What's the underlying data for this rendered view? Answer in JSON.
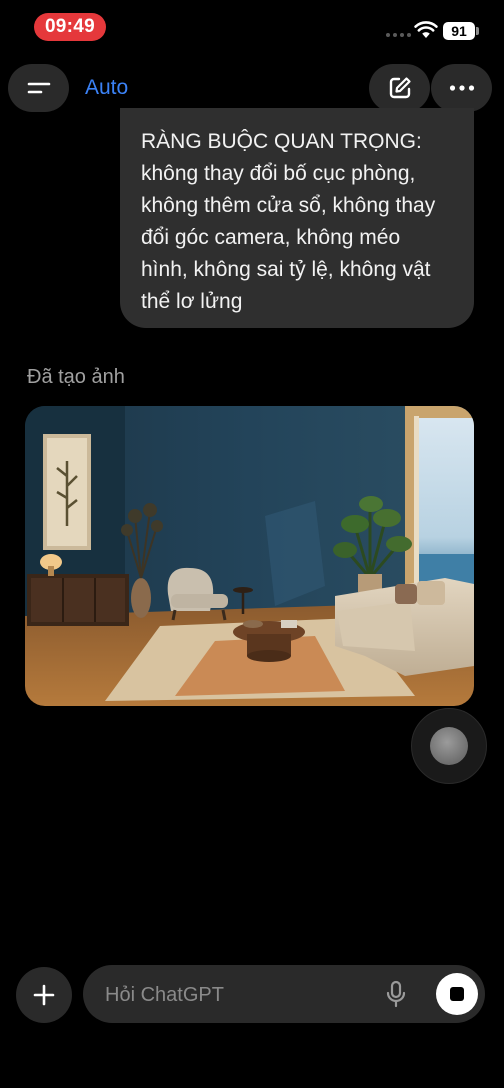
{
  "status_bar": {
    "time": "09:49",
    "battery": "91",
    "time_pill_color": "#e5383b"
  },
  "header": {
    "menu_icon": "menu-lines-icon",
    "model_label": "Auto",
    "new_chat_icon": "edit-icon",
    "more_icon": "more-horizontal-icon",
    "accent_color": "#3b82f6"
  },
  "conversation": {
    "user_message_lines": [
      "RÀNG BUỘC QUAN TRỌNG:",
      "không thay đổi bố cục phòng,",
      "không thêm cửa sổ, không thay",
      "đổi góc camera, không méo",
      "hình, không sai tỷ lệ, không vật",
      "thể lơ lửng"
    ],
    "generated_label": "Đã tạo ảnh"
  },
  "composer": {
    "add_icon": "plus-icon",
    "placeholder": "Hỏi ChatGPT",
    "mic_icon": "microphone-icon",
    "stop_icon": "stop-icon"
  }
}
